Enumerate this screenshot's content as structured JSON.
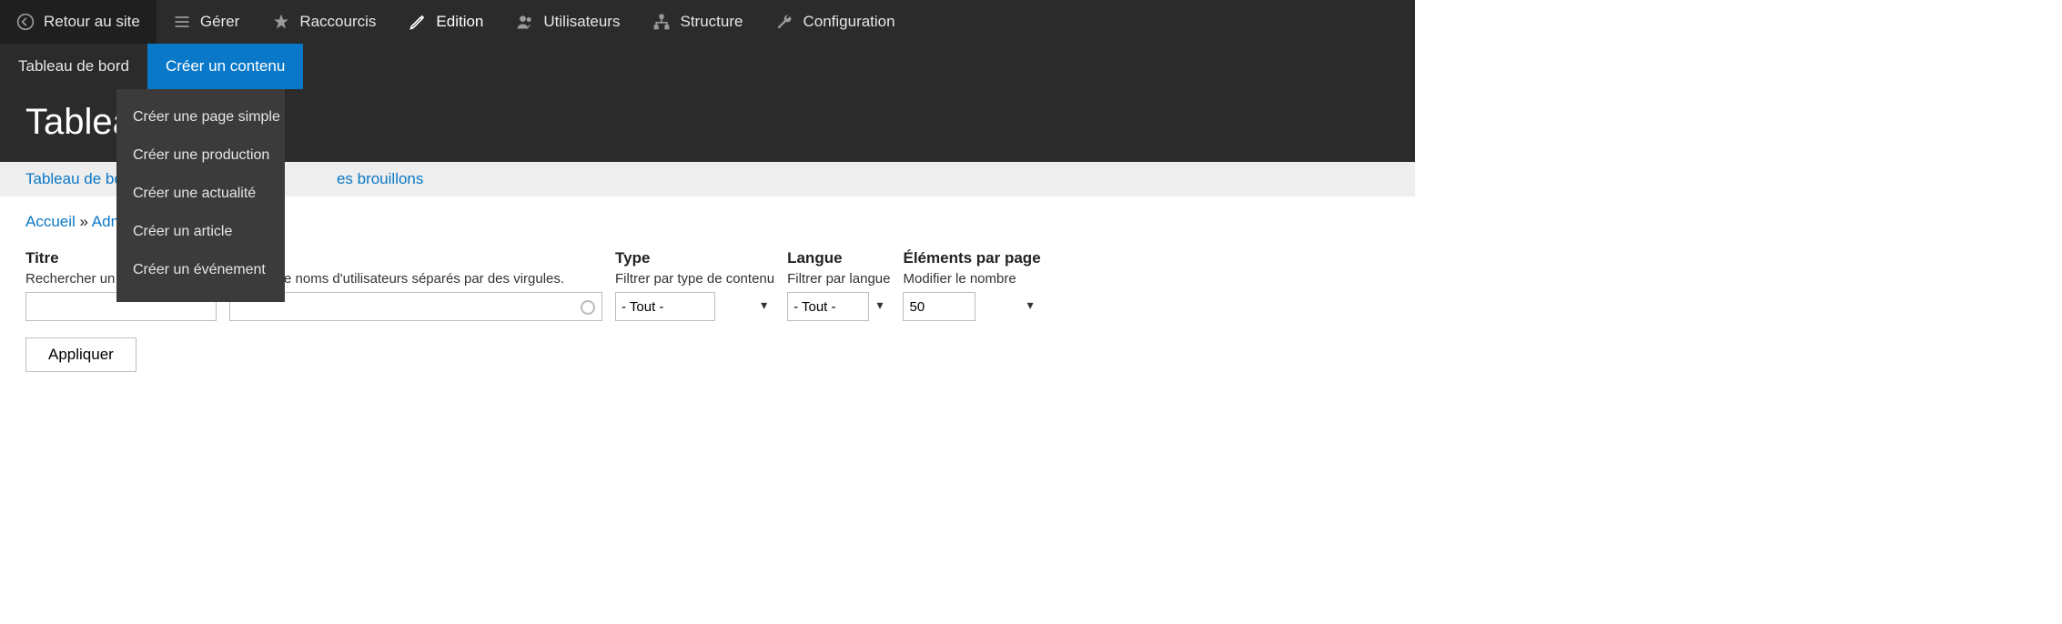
{
  "toolbar": {
    "back": "Retour au site",
    "manage": "Gérer",
    "shortcuts": "Raccourcis",
    "edition": "Edition",
    "users": "Utilisateurs",
    "structure": "Structure",
    "configuration": "Configuration"
  },
  "tabs": {
    "dashboard": "Tableau de bord",
    "create_content": "Créer un contenu"
  },
  "dropdown": {
    "items": [
      "Créer une page simple",
      "Créer une production",
      "Créer une actualité",
      "Créer un article",
      "Créer un événement"
    ]
  },
  "page_title": "Tableau",
  "subtabs": {
    "dashboard": "Tableau de bord",
    "drafts": "es brouillons"
  },
  "breadcrumb": {
    "home": "Accueil",
    "sep": " » ",
    "admin": "Adminis"
  },
  "filters": {
    "title": {
      "label": "Titre",
      "desc": "Rechercher un titr"
    },
    "author": {
      "desc": "ne liste de noms d'utilisateurs séparés par des virgules."
    },
    "type": {
      "label": "Type",
      "desc": "Filtrer par type de contenu",
      "value": "- Tout -"
    },
    "lang": {
      "label": "Langue",
      "desc": "Filtrer par langue",
      "value": "- Tout -"
    },
    "perpage": {
      "label": "Éléments par page",
      "desc": "Modifier le nombre",
      "value": "50"
    },
    "apply": "Appliquer"
  }
}
